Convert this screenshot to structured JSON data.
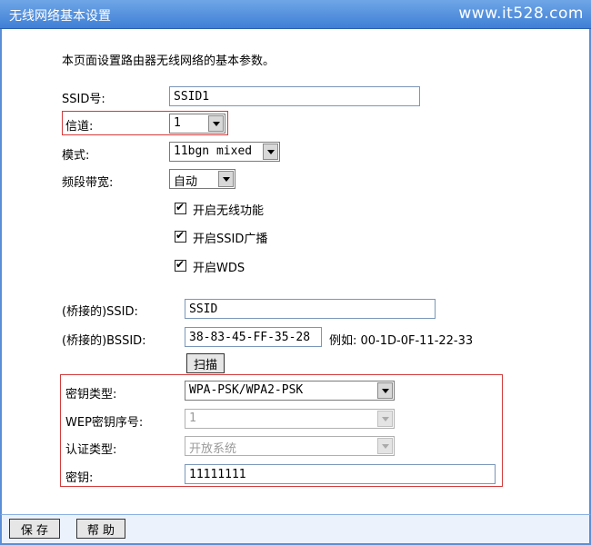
{
  "header": {
    "title": "无线网络基本设置",
    "watermark": "www.it528.com"
  },
  "description": "本页面设置路由器无线网络的基本参数。",
  "form": {
    "ssid_label": "SSID号:",
    "ssid_value": "SSID1",
    "channel_label": "信道:",
    "channel_value": "1",
    "mode_label": "模式:",
    "mode_value": "11bgn mixed",
    "bandwidth_label": "频段带宽:",
    "bandwidth_value": "自动",
    "enable_wireless_label": "开启无线功能",
    "enable_ssid_broadcast_label": "开启SSID广播",
    "enable_wds_label": "开启WDS",
    "bridge_ssid_label": "(桥接的)SSID:",
    "bridge_ssid_value": "SSID",
    "bridge_bssid_label": "(桥接的)BSSID:",
    "bridge_bssid_value": "38-83-45-FF-35-28",
    "bssid_example": "例如: 00-1D-0F-11-22-33",
    "scan_label": "扫描",
    "key_type_label": "密钥类型:",
    "key_type_value": "WPA-PSK/WPA2-PSK",
    "wep_index_label": "WEP密钥序号:",
    "wep_index_value": "1",
    "auth_type_label": "认证类型:",
    "auth_type_value": "开放系统",
    "key_label": "密钥:",
    "key_value": "11111111"
  },
  "footer": {
    "save_label": "保 存",
    "help_label": "帮 助"
  },
  "colors": {
    "title_bar": "#4a86dc",
    "highlight_box": "#d23b3b"
  }
}
